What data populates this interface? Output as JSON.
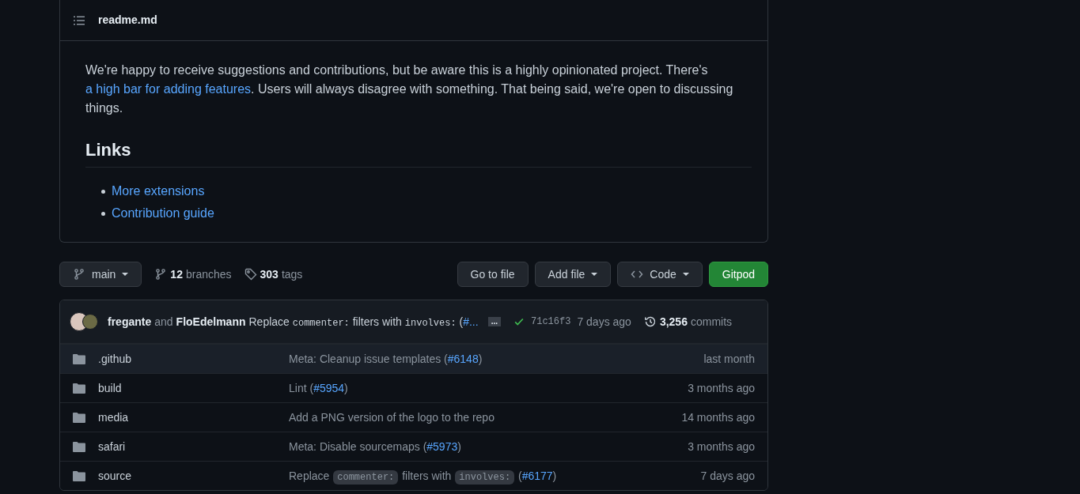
{
  "readme": {
    "title": "readme.md",
    "paragraphs": [
      [
        {
          "kind": "text",
          "text": "We're happy to receive suggestions and contributions, but be aware this is a highly opinionated project. There's "
        },
        {
          "kind": "link",
          "text": "a high bar for adding features"
        },
        {
          "kind": "text",
          "text": ". Users will always disagree with something. That being said, we're open to discussing things."
        }
      ]
    ],
    "heading": "Links",
    "links": [
      "More extensions",
      "Contribution guide"
    ]
  },
  "branch_bar": {
    "branch": "main",
    "branches_count": "12",
    "branches_label": "branches",
    "tags_count": "303",
    "tags_label": "tags",
    "buttons": [
      {
        "label": "Go to file",
        "kind": "plain"
      },
      {
        "label": "Add file",
        "kind": "dropdown"
      },
      {
        "label": "Code",
        "kind": "code"
      },
      {
        "label": "Gitpod",
        "kind": "primary"
      }
    ]
  },
  "latest_commit": {
    "author_1": "fregante",
    "joiner": "and",
    "author_2": "FloEdelmann",
    "message": [
      {
        "kind": "text",
        "text": "Replace "
      },
      {
        "kind": "code",
        "text": "commenter:"
      },
      {
        "kind": "text",
        "text": " filters with "
      },
      {
        "kind": "code",
        "text": "involves:"
      },
      {
        "kind": "text",
        "text": " ("
      },
      {
        "kind": "link",
        "text": "#..."
      }
    ],
    "more": "...",
    "sha": "71c16f3",
    "time": "7 days ago",
    "commits_count": "3,256",
    "commits_label": "commits"
  },
  "files": [
    {
      "name": ".github",
      "selected": true,
      "message": [
        {
          "kind": "text",
          "text": "Meta: Cleanup issue templates ("
        },
        {
          "kind": "link",
          "text": "#6148"
        },
        {
          "kind": "text",
          "text": ")"
        }
      ],
      "time": "last month"
    },
    {
      "name": "build",
      "selected": false,
      "message": [
        {
          "kind": "text",
          "text": "Lint ("
        },
        {
          "kind": "link",
          "text": "#5954"
        },
        {
          "kind": "text",
          "text": ")"
        }
      ],
      "time": "3 months ago"
    },
    {
      "name": "media",
      "selected": false,
      "message": [
        {
          "kind": "text",
          "text": "Add a PNG version of the logo to the repo"
        }
      ],
      "time": "14 months ago"
    },
    {
      "name": "safari",
      "selected": false,
      "message": [
        {
          "kind": "text",
          "text": "Meta: Disable sourcemaps ("
        },
        {
          "kind": "link",
          "text": "#5973"
        },
        {
          "kind": "text",
          "text": ")"
        }
      ],
      "time": "3 months ago"
    },
    {
      "name": "source",
      "selected": false,
      "message": [
        {
          "kind": "text",
          "text": "Replace "
        },
        {
          "kind": "code",
          "text": "commenter:"
        },
        {
          "kind": "text",
          "text": " filters with "
        },
        {
          "kind": "code",
          "text": "involves:"
        },
        {
          "kind": "text",
          "text": " ("
        },
        {
          "kind": "link",
          "text": "#6177"
        },
        {
          "kind": "text",
          "text": ")"
        }
      ],
      "time": "7 days ago"
    }
  ]
}
